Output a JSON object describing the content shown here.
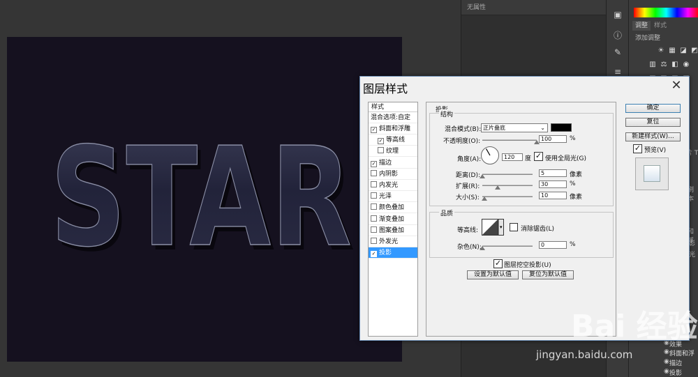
{
  "canvas": {
    "artwork_text": "STAR"
  },
  "properties_panel": {
    "header": "无属性"
  },
  "right_panel": {
    "tab_adjust": "调整",
    "tab_style": "样式",
    "add_adjustment": "添加调整",
    "layer_items": [
      "效果",
      "斜面和浮",
      "描边",
      "投影"
    ],
    "partial_labels": [
      "和浮",
      "刷本",
      "影",
      "光",
      "片 T"
    ]
  },
  "dialog": {
    "title": "图层样式",
    "style_list_header": "样式",
    "blend_options": "混合选项:自定",
    "styles": [
      {
        "label": "斜面和浮雕",
        "checked": true,
        "indent": false
      },
      {
        "label": "等高线",
        "checked": true,
        "indent": true
      },
      {
        "label": "纹理",
        "checked": false,
        "indent": true
      },
      {
        "label": "描边",
        "checked": true,
        "indent": false
      },
      {
        "label": "内阴影",
        "checked": false,
        "indent": false
      },
      {
        "label": "内发光",
        "checked": false,
        "indent": false
      },
      {
        "label": "光泽",
        "checked": false,
        "indent": false
      },
      {
        "label": "颜色叠加",
        "checked": false,
        "indent": false
      },
      {
        "label": "渐变叠加",
        "checked": false,
        "indent": false
      },
      {
        "label": "图案叠加",
        "checked": false,
        "indent": false
      },
      {
        "label": "外发光",
        "checked": false,
        "indent": false
      },
      {
        "label": "投影",
        "checked": true,
        "indent": false,
        "selected": true
      }
    ],
    "section_title": "投影",
    "structure": {
      "title": "结构",
      "blend_mode_label": "混合模式(B):",
      "blend_mode_value": "正片叠底",
      "opacity_label": "不透明度(O):",
      "opacity_value": "100",
      "opacity_fraction": 1.0,
      "percent": "%",
      "angle_label": "角度(A):",
      "angle_value": "120",
      "degree_unit": "度",
      "global_light_label": "使用全局光(G)",
      "global_light_checked": true,
      "distance_label": "距离(D):",
      "distance_value": "5",
      "distance_fraction": 0.0,
      "pixel_unit": "像素",
      "spread_label": "扩展(R):",
      "spread_value": "30",
      "spread_fraction": 0.3,
      "size_label": "大小(S):",
      "size_value": "10",
      "size_fraction": 0.04
    },
    "quality": {
      "title": "品质",
      "contour_label": "等高线:",
      "antialias_label": "消除锯齿(L)",
      "antialias_checked": false,
      "noise_label": "杂色(N):",
      "noise_value": "0",
      "noise_fraction": 0.0,
      "percent": "%"
    },
    "knockout_label": "图层挖空投影(U)",
    "knockout_checked": true,
    "set_default_button": "设置为默认值",
    "reset_default_button": "复位为默认值",
    "ok_button": "确定",
    "reset_button": "复位",
    "new_style_button": "新建样式(W)...",
    "preview_label": "预览(V)",
    "preview_checked": true
  },
  "watermark": {
    "logo_text": "Bai 经验",
    "site": "jingyan.baidu.com"
  },
  "colors": {
    "canvas_bg": "#15111f",
    "workspace_bg": "#353535",
    "selected_style": "#3399ff",
    "shadow_swatch": "#000000"
  }
}
